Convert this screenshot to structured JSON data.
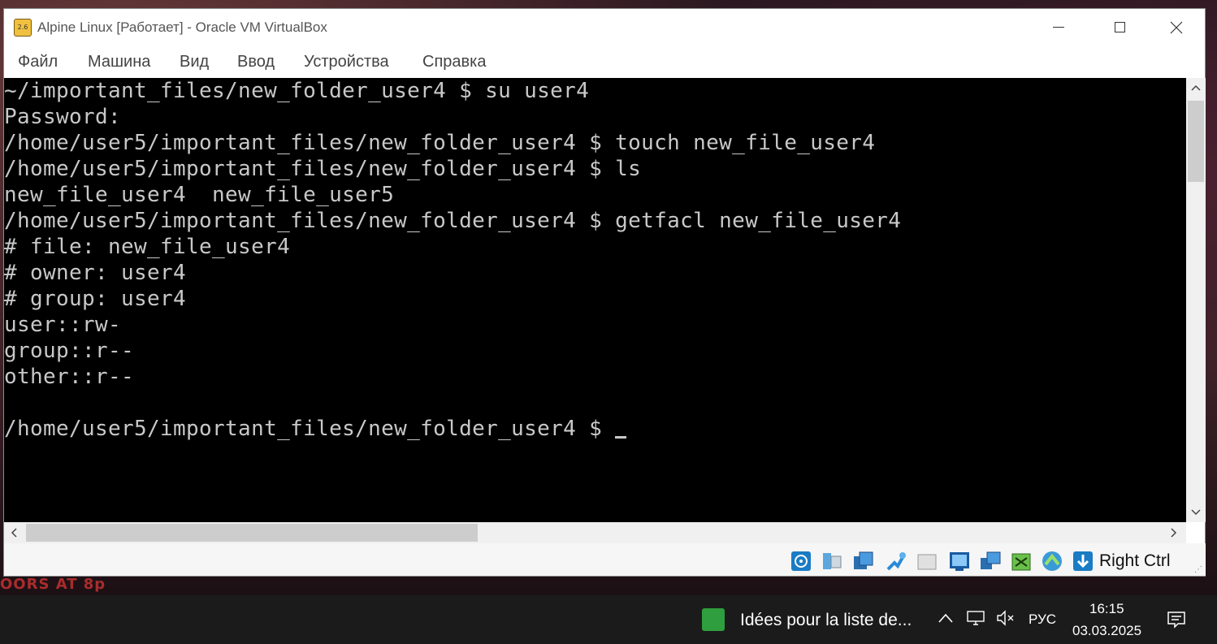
{
  "window": {
    "title": "Alpine Linux [Работает] - Oracle VM VirtualBox",
    "app_icon_text": "2.6",
    "minimize": "—",
    "maximize": "☐",
    "close": "✕"
  },
  "menu": [
    "Файл",
    "Машина",
    "Вид",
    "Ввод",
    "Устройства",
    "Справка"
  ],
  "terminal": {
    "lines": [
      "~/important_files/new_folder_user4 $ su user4",
      "Password:",
      "/home/user5/important_files/new_folder_user4 $ touch new_file_user4",
      "/home/user5/important_files/new_folder_user4 $ ls",
      "new_file_user4  new_file_user5",
      "/home/user5/important_files/new_folder_user4 $ getfacl new_file_user4",
      "# file: new_file_user4",
      "# owner: user4",
      "# group: user4",
      "user::rw-",
      "group::r--",
      "other::r--",
      "",
      "/home/user5/important_files/new_folder_user4 $ "
    ]
  },
  "statusbar": {
    "icons": [
      "hard-disk-icon",
      "optical-drive-icon",
      "audio-icon",
      "network-icon",
      "usb-icon",
      "shared-folders-icon",
      "display-icon",
      "video-capture-icon",
      "cpu-icon",
      "mouse-integration-icon",
      "download-icon"
    ],
    "host_key": "Right Ctrl"
  },
  "colors": {
    "terminal_bg": "#000000",
    "terminal_fg": "#c8c8c8",
    "taskbar_bg": "#1b1b1b"
  },
  "desktop": {
    "wallpaper_text": "OORS AT 8p"
  },
  "taskbar": {
    "news_text": "Idées pour la liste de...",
    "chevron": "^",
    "language": "РУС",
    "time": "16:15",
    "date": "03.03.2025"
  }
}
